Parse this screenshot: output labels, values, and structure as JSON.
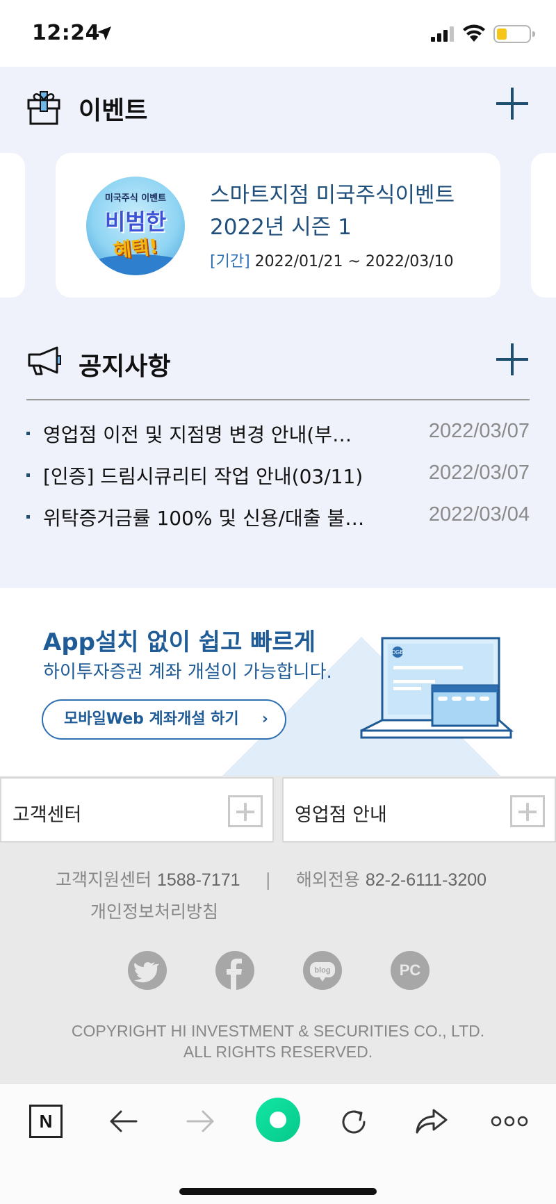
{
  "status_bar": {
    "time": "12:24"
  },
  "events": {
    "title": "이벤트",
    "card": {
      "thumb_line1": "미국주식 이벤트",
      "thumb_line2": "비범한",
      "thumb_line3": "혜택!",
      "title": "스마트지점 미국주식이벤트 2022년 시즌 1",
      "period_label": "[기간]",
      "period_value": "2022/01/21 ~ 2022/03/10"
    }
  },
  "notices": {
    "title": "공지사항",
    "items": [
      {
        "title": "영업점 이전 및 지점명 변경 안내(부…",
        "date": "2022/03/07"
      },
      {
        "title": "[인증] 드림시큐리티 작업 안내(03/11)",
        "date": "2022/03/07"
      },
      {
        "title": "위탁증거금률 100% 및 신용/대출 불…",
        "date": "2022/03/04"
      }
    ]
  },
  "promo": {
    "headline": "App설치 없이  쉽고 빠르게",
    "subline": "하이투자증권 계좌 개설이 가능합니다.",
    "button_label": "모바일Web 계좌개설 하기",
    "button_chevron": "›",
    "art_logo": "DGB"
  },
  "links": {
    "customer_center": "고객센터",
    "branch_info": "영업점 안내"
  },
  "footer": {
    "support_label": "고객지원센터",
    "support_number": "1588-7171",
    "separator": "|",
    "overseas_label": "해외전용",
    "overseas_number": "82-2-6111-3200",
    "privacy": "개인정보처리방침",
    "social": {
      "twitter": "twitter-icon",
      "facebook": "facebook-icon",
      "blog": "blog",
      "pc": "PC"
    },
    "copyright_line1": "COPYRIGHT HI INVESTMENT & SECURITIES CO., LTD.",
    "copyright_line2": "ALL RIGHTS RESERVED."
  },
  "toolbar": {
    "naver_label": "N"
  },
  "colors": {
    "accent_navy": "#1f4f70",
    "promo_blue": "#1f5b96",
    "content_bg": "#eff2fb",
    "footer_bg": "#e9e9e9",
    "green": "#06c98b"
  }
}
